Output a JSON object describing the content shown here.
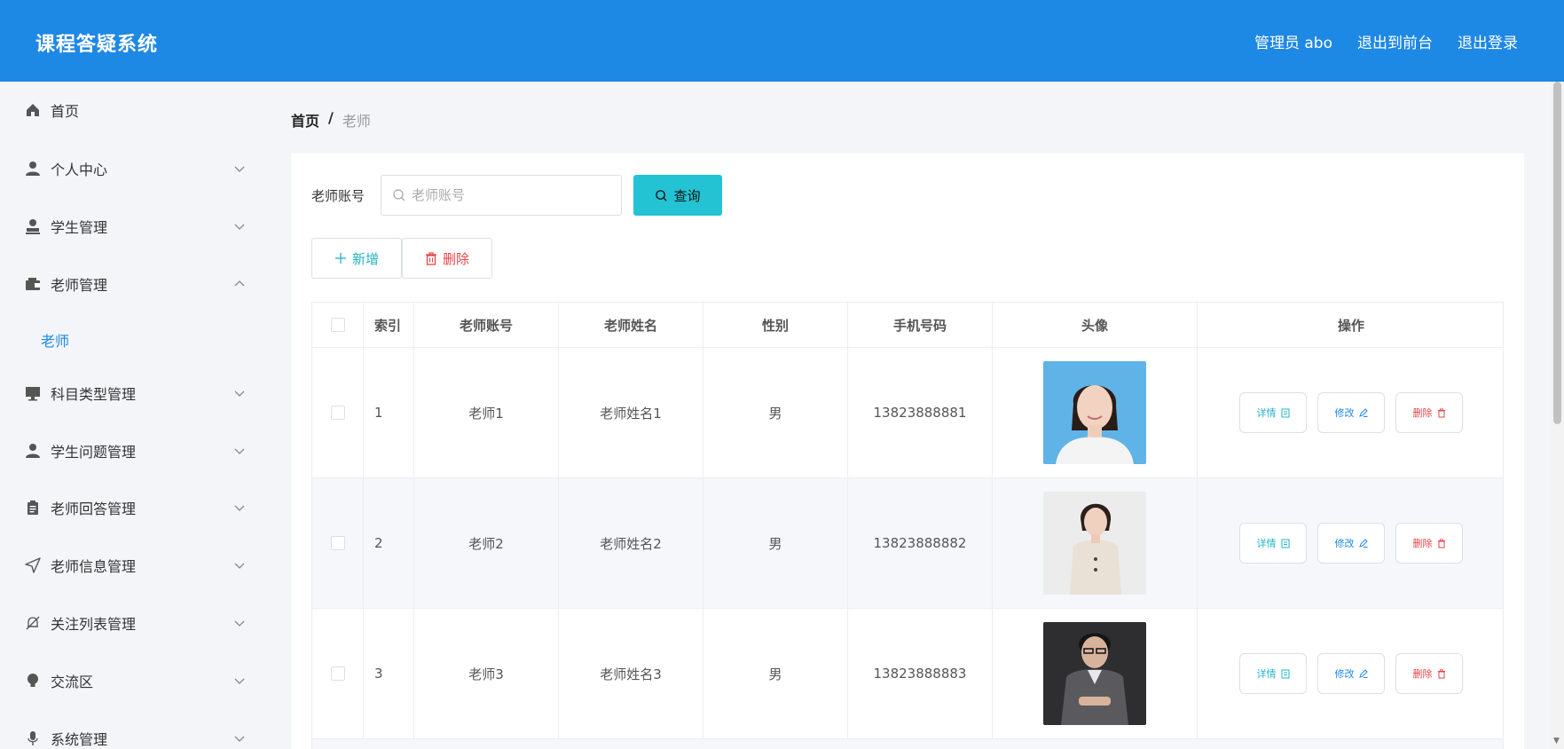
{
  "header": {
    "title": "课程答疑系统",
    "admin": "管理员 abo",
    "to_front": "退出到前台",
    "logout": "退出登录",
    "bg_color": "#1e88e5"
  },
  "sidebar": {
    "items": [
      {
        "label": "首页",
        "icon": "home-icon"
      },
      {
        "label": "个人中心",
        "icon": "user-icon"
      },
      {
        "label": "学生管理",
        "icon": "stamp-icon"
      },
      {
        "label": "老师管理",
        "icon": "wallet-icon"
      },
      {
        "label": "科目类型管理",
        "icon": "monitor-icon"
      },
      {
        "label": "学生问题管理",
        "icon": "user-icon"
      },
      {
        "label": "老师回答管理",
        "icon": "clipboard-icon"
      },
      {
        "label": "老师信息管理",
        "icon": "send-icon"
      },
      {
        "label": "关注列表管理",
        "icon": "bell-off-icon"
      },
      {
        "label": "交流区",
        "icon": "lightbulb-icon"
      },
      {
        "label": "系统管理",
        "icon": "microphone-icon"
      }
    ],
    "sub_active": "老师",
    "accent": "#1e88e5"
  },
  "breadcrumb": {
    "home": "首页",
    "sep": "/",
    "current": "老师"
  },
  "search": {
    "label": "老师账号",
    "placeholder": "老师账号",
    "button": "查询",
    "button_color": "#23c3d3"
  },
  "actions": {
    "add": "新增",
    "delete": "删除"
  },
  "table": {
    "headers": {
      "index": "索引",
      "account": "老师账号",
      "name": "老师姓名",
      "sex": "性别",
      "phone": "手机号码",
      "avatar": "头像",
      "ops": "操作"
    },
    "rows": [
      {
        "index": "1",
        "account": "老师1",
        "name": "老师姓名1",
        "sex": "男",
        "phone": "13823888881"
      },
      {
        "index": "2",
        "account": "老师2",
        "name": "老师姓名2",
        "sex": "男",
        "phone": "13823888882"
      },
      {
        "index": "3",
        "account": "老师3",
        "name": "老师姓名3",
        "sex": "男",
        "phone": "13823888883"
      }
    ],
    "row_ops": {
      "detail": "详情",
      "edit": "修改",
      "delete": "删除"
    }
  }
}
